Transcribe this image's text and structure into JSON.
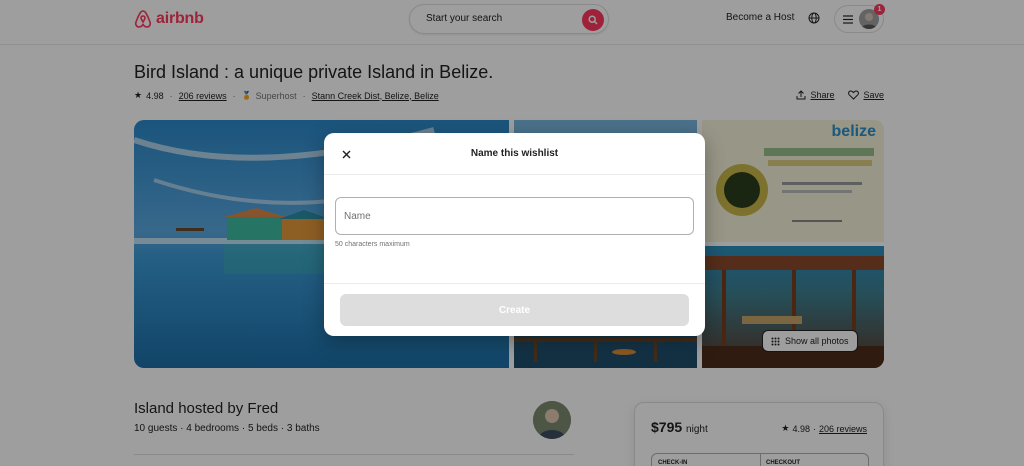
{
  "header": {
    "brand": "airbnb",
    "search_label": "Start your search",
    "become_host": "Become a Host",
    "notification_count": "1"
  },
  "listing": {
    "title": "Bird Island : a unique private Island in Belize.",
    "rating": "4.98",
    "reviews": "206 reviews",
    "superhost": "Superhost",
    "location": "Stann Creek Dist, Belize, Belize",
    "share": "Share",
    "save": "Save",
    "show_all_photos": "Show all photos",
    "photo_4_text": "belize"
  },
  "host": {
    "title": "Island hosted by Fred",
    "details": "10 guests · 4 bedrooms · 5 beds · 3 baths"
  },
  "booking": {
    "price": "$795",
    "unit": "night",
    "rating": "4.98",
    "reviews": "206 reviews",
    "checkin": "CHECK-IN",
    "checkout": "CHECKOUT"
  },
  "modal": {
    "title": "Name this wishlist",
    "placeholder": "Name",
    "hint": "50 characters maximum",
    "create": "Create"
  },
  "colors": {
    "brand": "#ff385c",
    "disabled_button": "#dddddd"
  }
}
